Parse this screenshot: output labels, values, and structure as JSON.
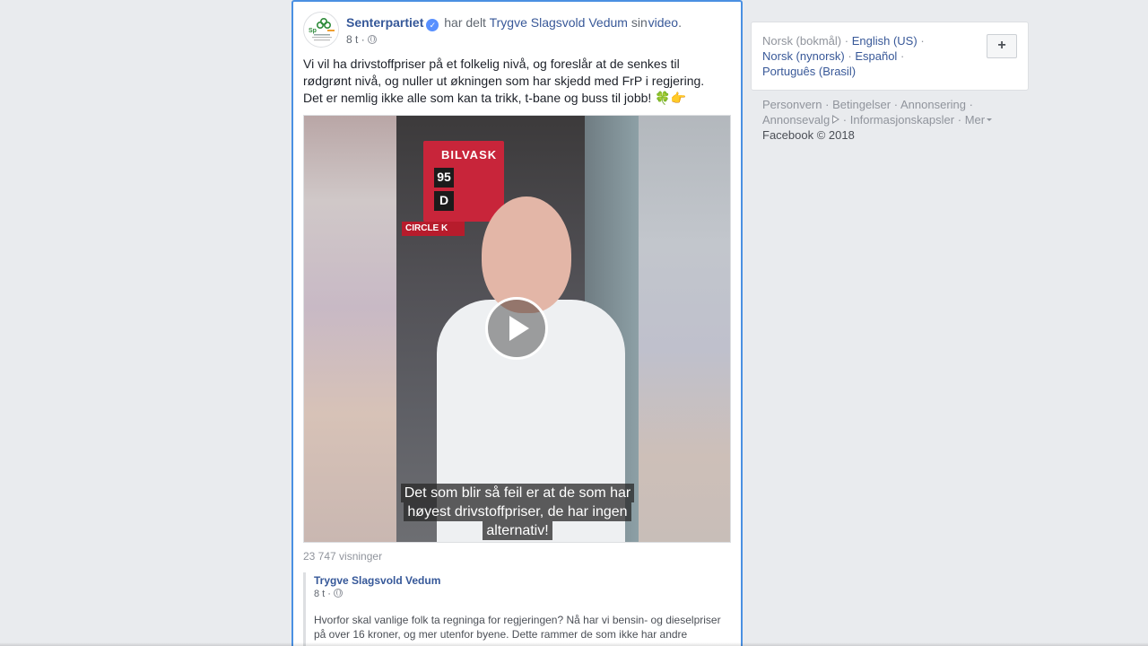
{
  "post": {
    "page_name": "Senterpartiet",
    "shared_text": "har delt",
    "shared_from": "Trygve Slagsvold Vedum",
    "shared_possessive": "sin",
    "shared_type": "video",
    "period": ".",
    "time": "8 t",
    "meta_sep": "·",
    "text_lines": [
      "Vi vil ha drivstoffpriser på et folkelig nivå, og foreslår at de senkes til",
      "rødgrønt nivå, og nuller ut økningen som har skjedd med FrP i regjering.",
      "Det er nemlig ikke alle som kan ta trikk, t-bane og buss til jobb!"
    ],
    "text_emojis": "🍀👉",
    "video": {
      "subtitle_lines": [
        "Det som blir så feil er at de som har",
        "høyest drivstoffpriser, de har ingen",
        "alternativ!"
      ],
      "sign_text": "BILVASK",
      "price_1": "95",
      "price_2": "D",
      "brand": "CIRCLE K"
    },
    "views": "23 747 visninger",
    "original": {
      "author": "Trygve Slagsvold Vedum",
      "time": "8 t",
      "text_lines": [
        "Hvorfor skal vanlige folk ta regninga for regjeringen? Nå har vi bensin- og dieselpriser",
        "på over 16 kroner, og mer utenfor byene. Dette rammer de som ikke har andre"
      ]
    }
  },
  "sidebar": {
    "languages": {
      "current": "Norsk (bokmål)",
      "options": [
        "English (US)",
        "Norsk (nynorsk)",
        "Español",
        "Português (Brasil)"
      ],
      "add_label": "+"
    },
    "footer": {
      "links": [
        "Personvern",
        "Betingelser",
        "Annonsering",
        "Annonsevalg",
        "Informasjonskapsler",
        "Mer"
      ],
      "copyright": "Facebook © 2018"
    }
  },
  "colors": {
    "link": "#385898",
    "card_border_focus": "#4a90e2",
    "background": "#e9ebee"
  }
}
